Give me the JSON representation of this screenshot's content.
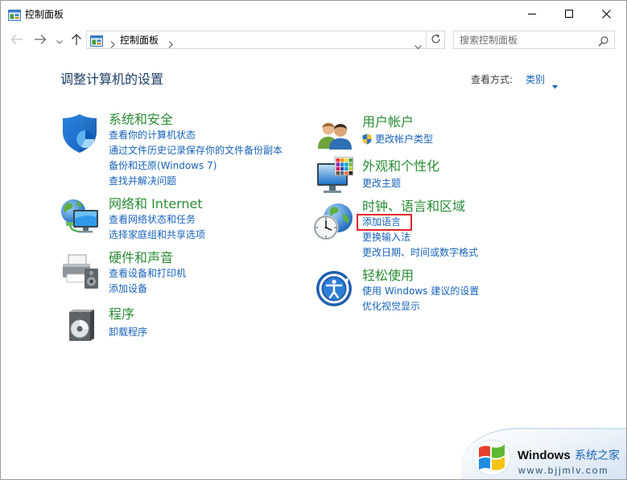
{
  "window": {
    "title": "控制面板",
    "icon": "control-panel-icon",
    "controls": [
      "minimize-icon",
      "maximize-icon",
      "close-icon"
    ]
  },
  "nav": {
    "back_enabled": false,
    "forward_enabled": true,
    "breadcrumb": [
      "控制面板"
    ],
    "search_placeholder": "搜索控制面板"
  },
  "main": {
    "heading": "调整计算机的设置",
    "view_by_label": "查看方式:",
    "view_by_value": "类别"
  },
  "categories": {
    "left": [
      {
        "title": "系统和安全",
        "icon": "shield-icon",
        "links": [
          "查看你的计算机状态",
          "通过文件历史记录保存你的文件备份副本",
          "备份和还原(Windows 7)",
          "查找并解决问题"
        ]
      },
      {
        "title": "网络和 Internet",
        "icon": "network-globe-icon",
        "links": [
          "查看网络状态和任务",
          "选择家庭组和共享选项"
        ]
      },
      {
        "title": "硬件和声音",
        "icon": "printer-speaker-icon",
        "links": [
          "查看设备和打印机",
          "添加设备"
        ]
      },
      {
        "title": "程序",
        "icon": "program-disc-icon",
        "links": [
          "卸载程序"
        ]
      }
    ],
    "right": [
      {
        "title": "用户帐户",
        "icon": "users-icon",
        "links": [
          "更改帐户类型"
        ],
        "link_icon": "uac-shield-icon"
      },
      {
        "title": "外观和个性化",
        "icon": "monitor-palette-icon",
        "links": [
          "更改主题"
        ]
      },
      {
        "title": "时钟、语言和区域",
        "icon": "globe-clock-icon",
        "links": [
          "添加语言",
          "更换输入法",
          "更改日期、时间或数字格式"
        ],
        "highlighted_link_index": 0
      },
      {
        "title": "轻松使用",
        "icon": "ease-of-access-icon",
        "links": [
          "使用 Windows 建议的设置",
          "优化视觉显示"
        ]
      }
    ]
  },
  "watermark": {
    "logo": "windows-flag-logo",
    "brand": "Windows",
    "name": "系统之家",
    "url": "www.bjjmlv.com"
  },
  "colors": {
    "title_green": "#2a8c35",
    "link_blue": "#1763b8",
    "heading_blue": "#1e3f66",
    "highlight_red": "#e0262b",
    "watermark_blue": "#1b64b8"
  }
}
